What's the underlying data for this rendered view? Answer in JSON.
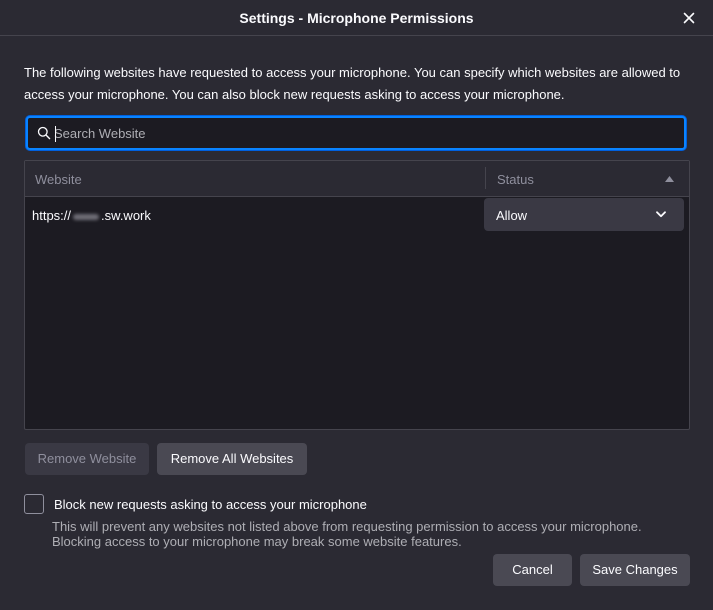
{
  "dialog": {
    "title": "Settings - Microphone Permissions",
    "description": "The following websites have requested to access your microphone. You can specify which websites are allowed to access your microphone. You can also block new requests asking to access your microphone."
  },
  "search": {
    "placeholder": "Search Website",
    "value": ""
  },
  "table": {
    "columns": [
      "Website",
      "Status"
    ],
    "rows": [
      {
        "site_prefix": "https://",
        "site_suffix": ".sw.work",
        "status": "Allow"
      }
    ]
  },
  "buttons": {
    "remove_website": "Remove Website",
    "remove_all": "Remove All Websites",
    "cancel": "Cancel",
    "save": "Save Changes"
  },
  "block": {
    "label": "Block new requests asking to access your microphone",
    "description_line1": "This will prevent any websites not listed above from requesting permission to access your microphone.",
    "description_line2": "Blocking access to your microphone may break some website features.",
    "checked": false
  },
  "colors": {
    "background": "#2b2a33",
    "accent": "#0a84ff",
    "table_bg": "#1c1b22"
  },
  "icons": [
    "close-icon",
    "search-icon",
    "sort-up-icon",
    "chevron-down-icon"
  ]
}
